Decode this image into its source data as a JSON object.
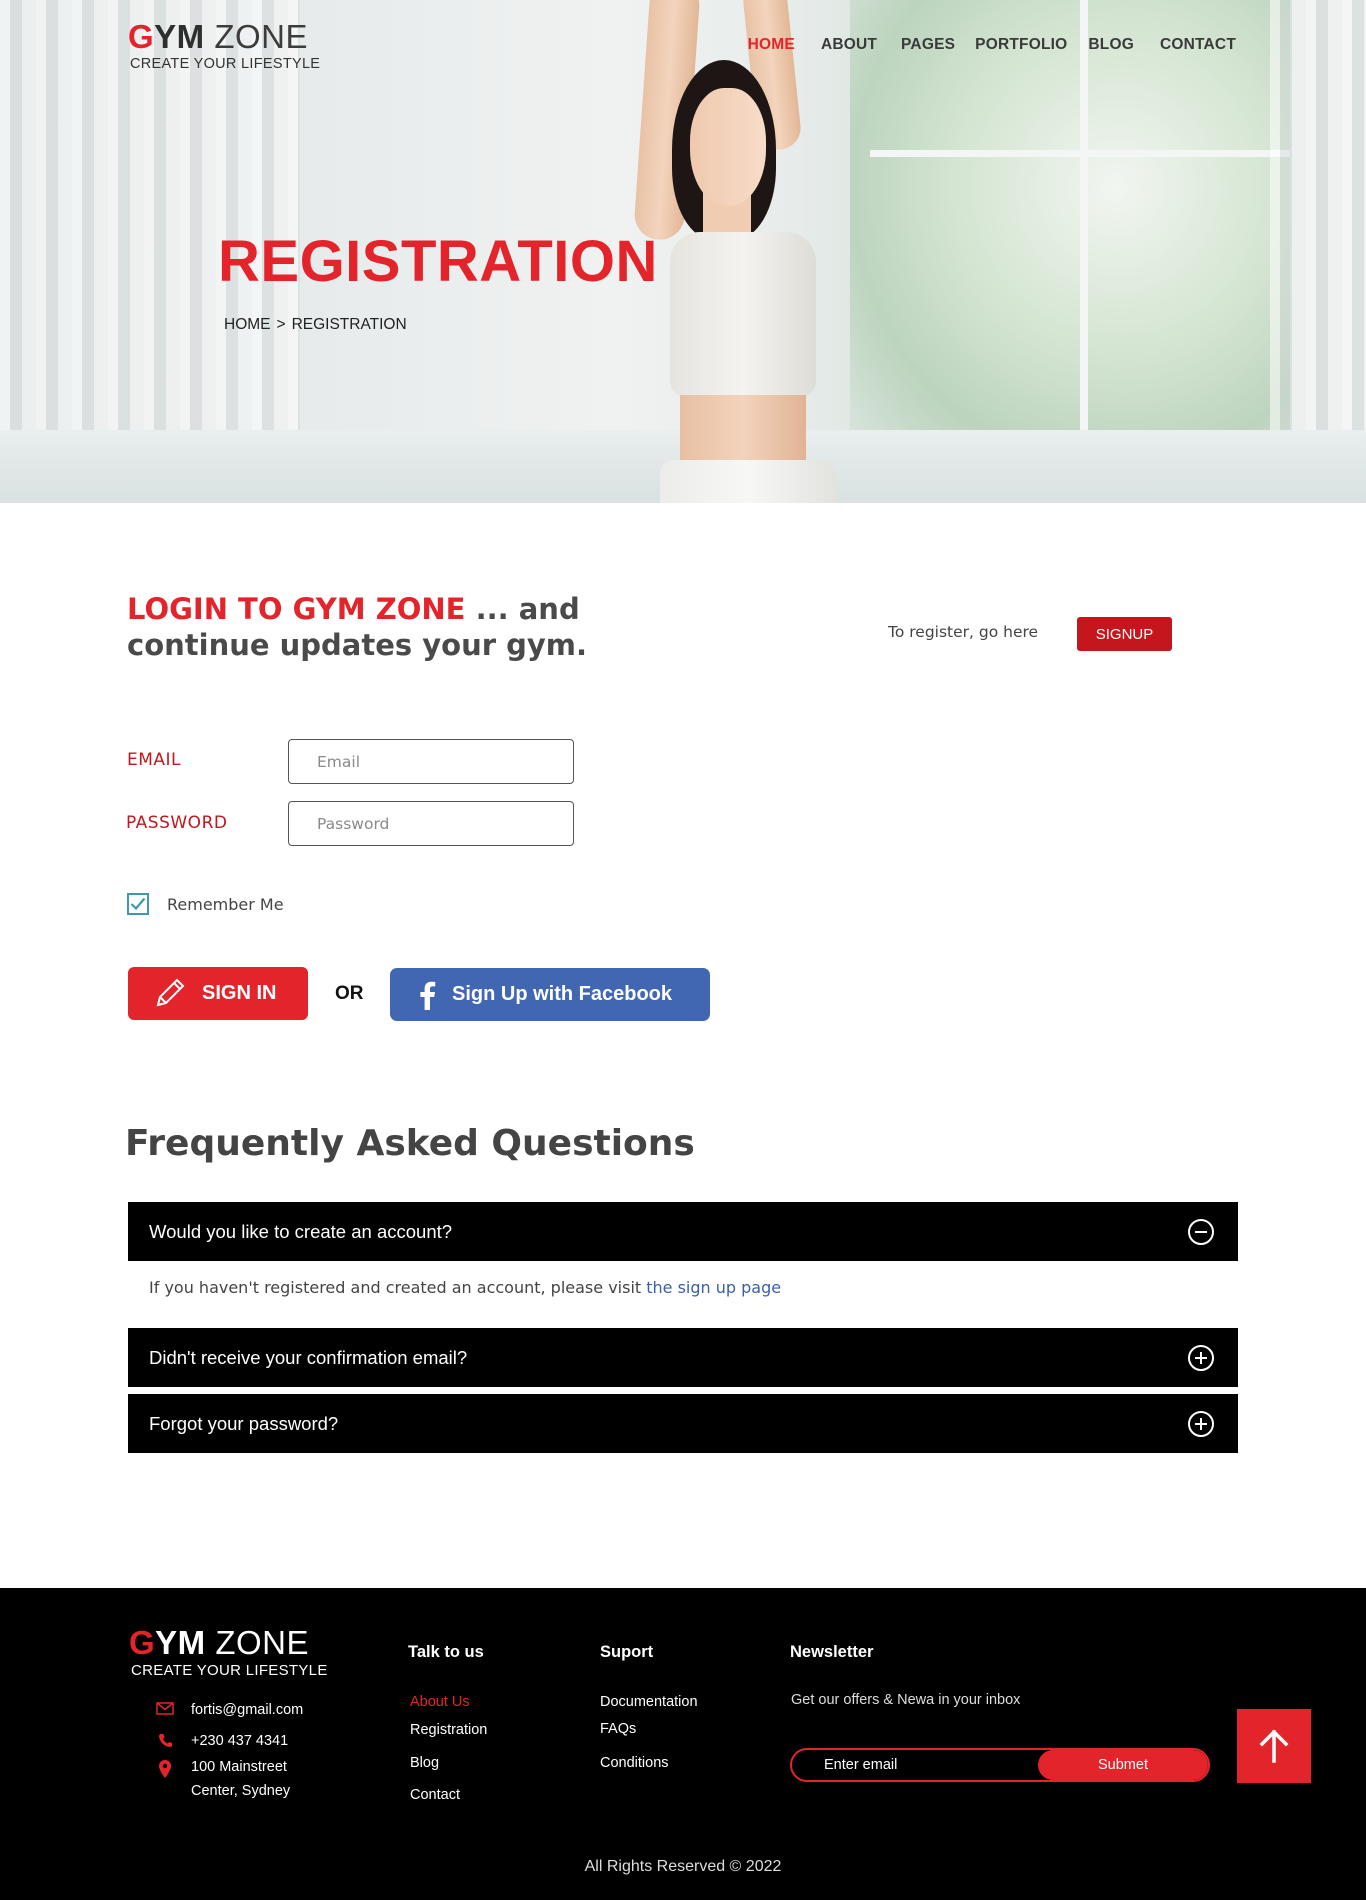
{
  "brand": {
    "logo_g": "G",
    "logo_ym": "YM",
    "logo_zone": " ZONE",
    "tagline": "CREATE YOUR LIFESTYLE",
    "accent_color": "#e3242b"
  },
  "nav": {
    "items": [
      {
        "label": "HOME",
        "active": true
      },
      {
        "label": "ABOUT"
      },
      {
        "label": "PAGES"
      },
      {
        "label": "PORTFOLIO"
      },
      {
        "label": "BLOG"
      },
      {
        "label": "CONTACT"
      }
    ]
  },
  "hero": {
    "title": "REGISTRATION",
    "breadcrumb": [
      "HOME",
      ">",
      "REGISTRATION"
    ]
  },
  "login": {
    "heading_red": "LOGIN TO GYM ZONE",
    "heading_rest": " ... and continue updates your gym.",
    "register_note": "To register, go here",
    "signup_label": "SIGNUP",
    "email_label": "EMAIL",
    "email_placeholder": "Email",
    "password_label": "PASSWORD",
    "password_placeholder": "Password",
    "remember_label": "Remember Me",
    "remember_checked": true,
    "signin_label": "SIGN IN",
    "or_label": "OR",
    "facebook_label": "Sign Up with Facebook",
    "facebook_color": "#4267b2"
  },
  "faq": {
    "title": "Frequently Asked Questions",
    "items": [
      {
        "question": "Would you like to create an account?",
        "expanded": true
      },
      {
        "question": "Didn't receive your confirmation email?",
        "expanded": false
      },
      {
        "question": "Forgot your password?",
        "expanded": false
      }
    ],
    "answer_text": "If you haven't registered and created an account, please visit ",
    "answer_link": "the sign up page"
  },
  "footer": {
    "contact": {
      "email": "fortis@gmail.com",
      "phone": "+230 437 4341",
      "address_line1": "100 Mainstreet",
      "address_line2": "Center, Sydney"
    },
    "talk": {
      "title": "Talk to us",
      "links": [
        "About Us",
        "Registration",
        "Blog",
        "Contact"
      ]
    },
    "support": {
      "title": "Suport",
      "links": [
        "Documentation",
        "FAQs",
        "Conditions"
      ]
    },
    "newsletter": {
      "title": "Newsletter",
      "text": "Get our offers & Newa in your inbox",
      "placeholder": "Enter email",
      "button": "Submet"
    },
    "copyright": "All Rights Reserved © 2022"
  }
}
